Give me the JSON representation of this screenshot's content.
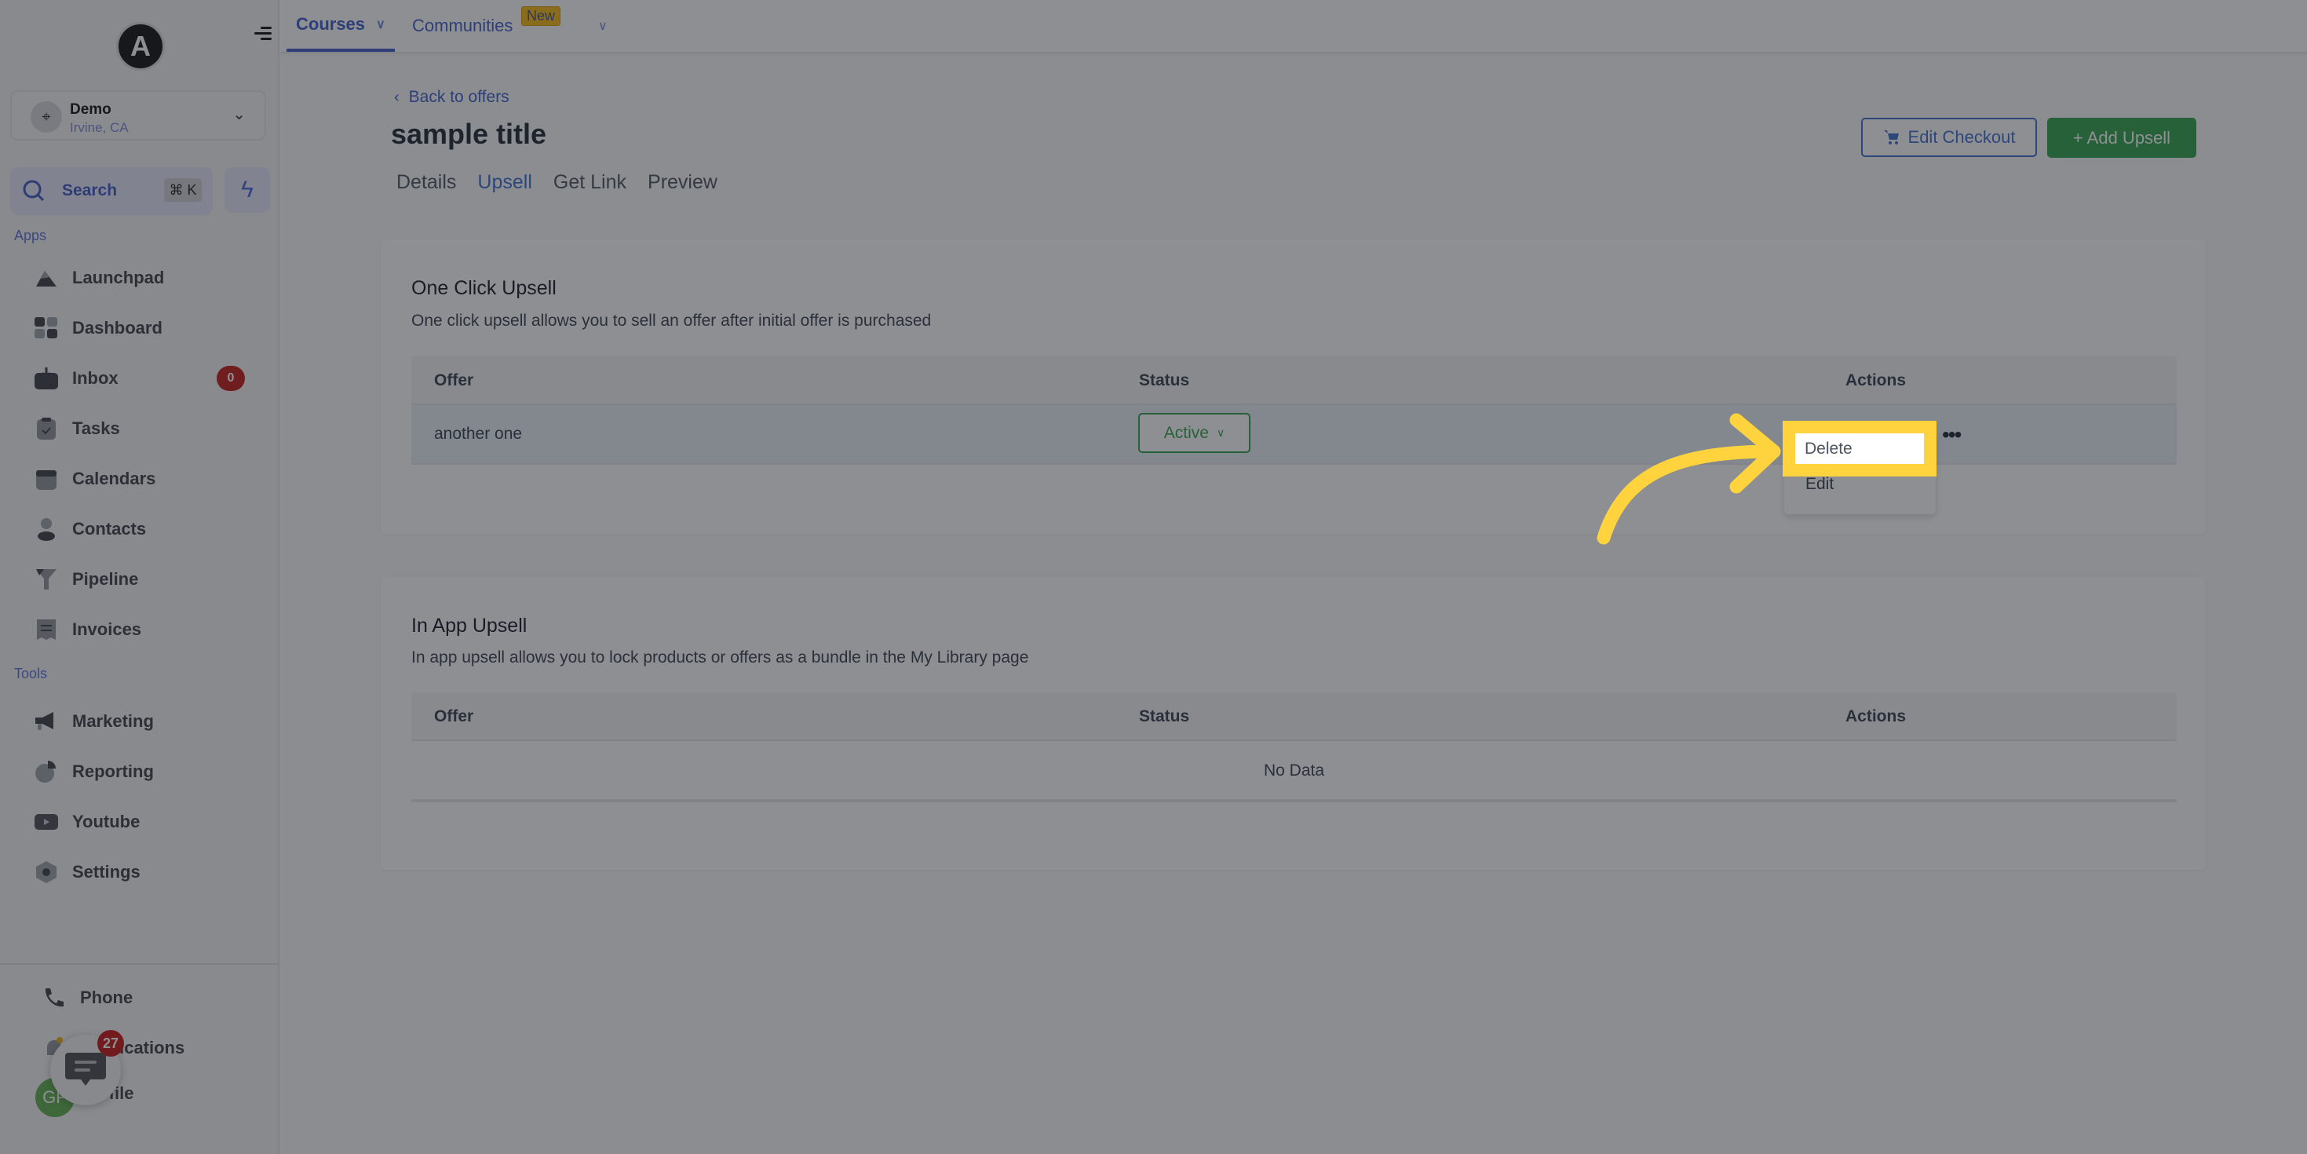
{
  "sidebar": {
    "logo_letter": "A",
    "location": {
      "name": "Demo",
      "subtitle": "Irvine, CA"
    },
    "search": {
      "label": "Search",
      "shortcut": "⌘ K"
    },
    "apps_label": "Apps",
    "apps": [
      {
        "label": "Launchpad",
        "icon": "rocket-icon"
      },
      {
        "label": "Dashboard",
        "icon": "grid-icon"
      },
      {
        "label": "Inbox",
        "icon": "inbox-icon",
        "badge": "0"
      },
      {
        "label": "Tasks",
        "icon": "clipboard-icon"
      },
      {
        "label": "Calendars",
        "icon": "calendar-icon"
      },
      {
        "label": "Contacts",
        "icon": "user-icon"
      },
      {
        "label": "Pipeline",
        "icon": "funnel-icon"
      },
      {
        "label": "Invoices",
        "icon": "invoice-icon"
      }
    ],
    "tools_label": "Tools",
    "tools": [
      {
        "label": "Marketing",
        "icon": "megaphone-icon"
      },
      {
        "label": "Reporting",
        "icon": "pie-chart-icon"
      },
      {
        "label": "Youtube",
        "icon": "youtube-icon"
      },
      {
        "label": "Settings",
        "icon": "gear-icon"
      }
    ],
    "bottom": [
      {
        "label": "Phone",
        "icon": "phone-icon"
      },
      {
        "label": "Notifications",
        "icon": "bell-icon"
      },
      {
        "label": "Profile",
        "icon": "avatar"
      }
    ],
    "avatar_initials": "GP",
    "chat_badge": "27"
  },
  "topnav": {
    "tabs": [
      {
        "label": "Courses",
        "active": true
      },
      {
        "label": "Communities",
        "badge": "New"
      }
    ]
  },
  "page": {
    "back_link": "Back to offers",
    "title": "sample title",
    "tabs": [
      "Details",
      "Upsell",
      "Get Link",
      "Preview"
    ],
    "active_tab": "Upsell",
    "edit_checkout": "Edit Checkout",
    "add_upsell": "+ Add Upsell"
  },
  "one_click": {
    "title": "One Click Upsell",
    "subtitle": "One click upsell allows you to sell an offer after initial offer is purchased",
    "columns": [
      "Offer",
      "Status",
      "Actions"
    ],
    "rows": [
      {
        "offer": "another one",
        "status": "Active"
      }
    ],
    "menu": [
      "Delete",
      "Edit"
    ]
  },
  "in_app": {
    "title": "In App Upsell",
    "subtitle": "In app upsell allows you to lock products or offers as a bundle in the My Library page",
    "columns": [
      "Offer",
      "Status",
      "Actions"
    ],
    "empty": "No Data"
  },
  "colors": {
    "accent": "#3d5ccc",
    "success": "#31a24c",
    "highlight": "#ffd33d",
    "badge": "#c21b1b"
  }
}
